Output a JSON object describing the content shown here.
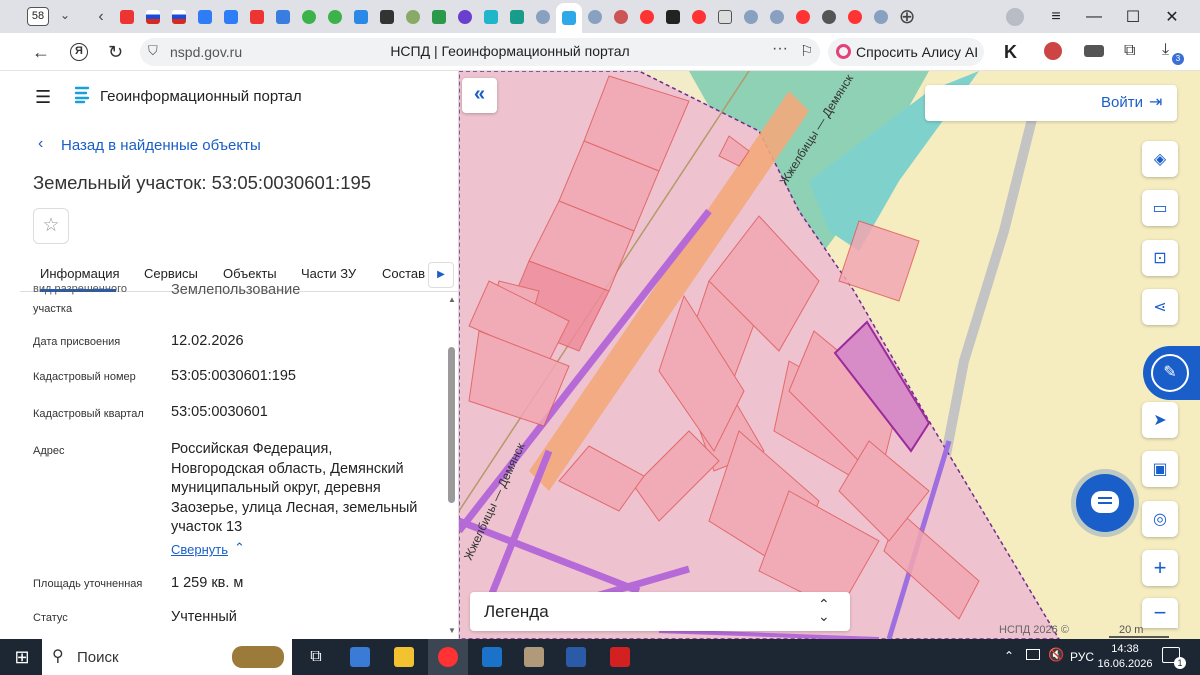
{
  "browser": {
    "tab_count": "58",
    "url": "nspd.gov.ru",
    "page_title": "НСПД | Геоинформационный портал",
    "alice_label": "Спросить Алису AI",
    "downloads_badge": "3"
  },
  "portal": {
    "title": "Геоинформационный портал",
    "back_link": "Назад в найденные объекты",
    "object_heading": "Земельный участок: 53:05:0030601:195",
    "tabs": [
      "Информация",
      "Сервисы",
      "Объекты",
      "Части ЗУ",
      "Состав"
    ]
  },
  "info": {
    "partial_label_1": "вид разрешенного",
    "partial_label_2": "участка",
    "partial_value": "Землепользование",
    "date_label": "Дата присвоения",
    "date_value": "12.02.2026",
    "cadnum_label": "Кадастровый номер",
    "cadnum_value": "53:05:0030601:195",
    "quarter_label": "Кадастровый квартал",
    "quarter_value": "53:05:0030601",
    "address_label": "Адрес",
    "address_lines": [
      "Российская Федерация,",
      "Новгородская область, Демянский",
      "муниципальный округ, деревня",
      "Заозерье, улица Лесная, земельный",
      "участок 13"
    ],
    "collapse_label": "Свернуть",
    "area_label": "Площадь уточненная",
    "area_value": "1 259 кв. м",
    "status_label": "Статус",
    "status_value": "Учтенный"
  },
  "map": {
    "login_label": "Войти",
    "road_label_1": "Жжелбицы — Демянск",
    "road_label_2": "Жжелбицы — Демянск",
    "legend_label": "Легенда",
    "copyright": "НСПД 2026 ©",
    "scale": "20 m",
    "accent": "#1a5ec9"
  },
  "taskbar": {
    "search_label": "Поиск",
    "lang": "РУС",
    "time": "14:38",
    "date": "16.06.2026",
    "notif_count": "1"
  }
}
